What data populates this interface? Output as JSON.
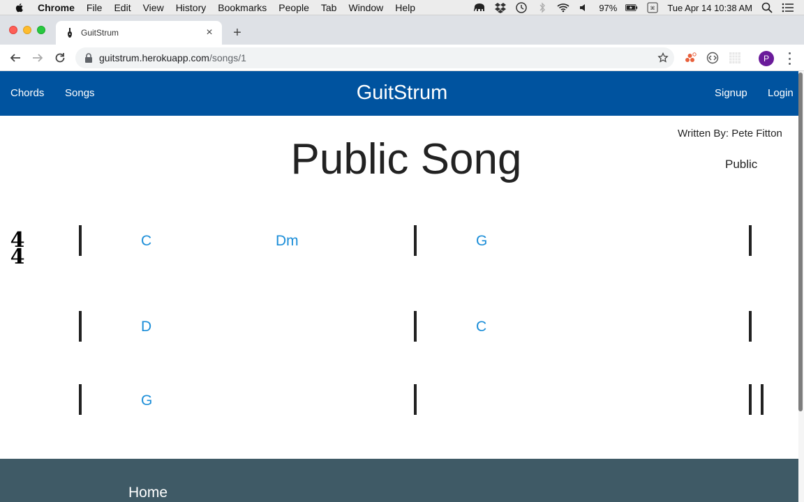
{
  "menubar": {
    "app": "Chrome",
    "items": [
      "File",
      "Edit",
      "View",
      "History",
      "Bookmarks",
      "People",
      "Tab",
      "Window",
      "Help"
    ],
    "battery": "97%",
    "datetime": "Tue Apr 14  10:38 AM"
  },
  "browser": {
    "tab_title": "GuitStrum",
    "url_host": "guitstrum.herokuapp.com",
    "url_path": "/songs/1",
    "profile_initial": "P"
  },
  "nav": {
    "brand": "GuitStrum",
    "left_links": [
      "Chords",
      "Songs"
    ],
    "right_links": [
      "Signup",
      "Login"
    ]
  },
  "song": {
    "title": "Public Song",
    "written_by": "Written By: Pete Fitton",
    "visibility": "Public",
    "time_signature": {
      "top": "4",
      "bottom": "4"
    },
    "rows": [
      {
        "chords": [
          "C",
          "Dm",
          "G"
        ]
      },
      {
        "chords": [
          "D",
          "C"
        ]
      },
      {
        "chords": [
          "G"
        ],
        "end": "final-double-barline"
      }
    ]
  },
  "footer": {
    "link": "Home"
  },
  "colors": {
    "navbar": "#00539f",
    "chord": "#1a8dd8",
    "footer": "#3f5a66"
  }
}
